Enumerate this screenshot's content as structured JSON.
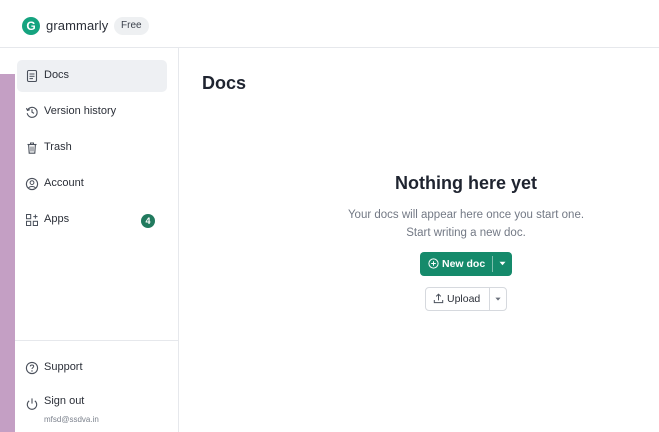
{
  "header": {
    "logo_letter": "G",
    "brand": "grammarly",
    "plan_badge": "Free"
  },
  "sidebar": {
    "items": [
      {
        "label": "Docs",
        "icon": "document-icon",
        "active": true
      },
      {
        "label": "Version history",
        "icon": "history-icon"
      },
      {
        "label": "Trash",
        "icon": "trash-icon"
      },
      {
        "label": "Account",
        "icon": "account-icon"
      },
      {
        "label": "Apps",
        "icon": "apps-icon",
        "badge": "4"
      }
    ],
    "bottom": [
      {
        "label": "Support",
        "icon": "help-icon"
      },
      {
        "label": "Sign out",
        "icon": "power-icon",
        "sublabel": "mfsd@ssdva.in"
      }
    ]
  },
  "main": {
    "title": "Docs",
    "empty_state": {
      "title": "Nothing here yet",
      "line1": "Your docs will appear here once you start one.",
      "line2": "Start writing a new doc.",
      "new_doc_label": "New doc",
      "upload_label": "Upload"
    }
  },
  "colors": {
    "brand_green": "#15a37f",
    "button_green": "#158a6b",
    "badge_green": "#217a5e",
    "side_accent": "#c49fc4"
  }
}
